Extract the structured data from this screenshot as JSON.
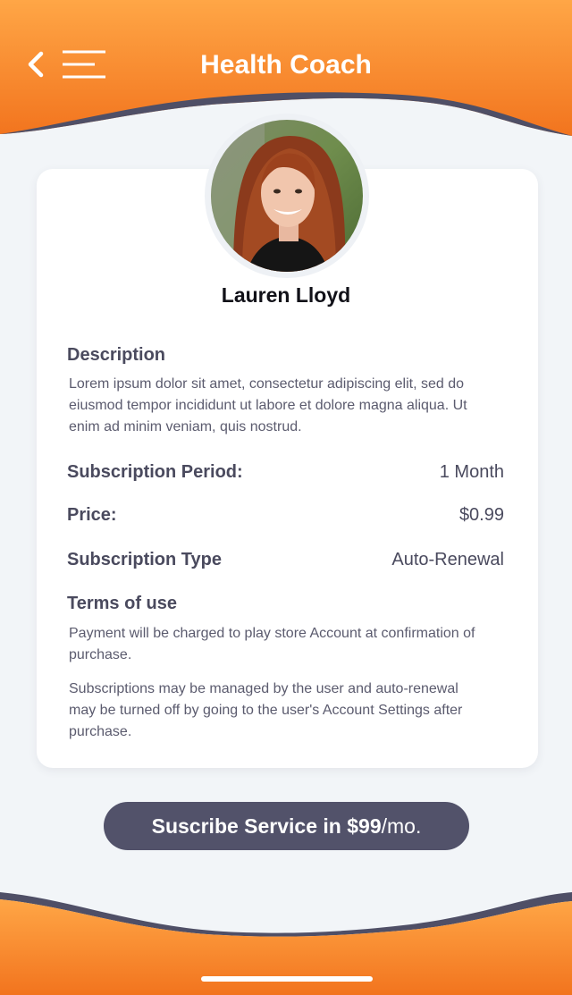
{
  "header": {
    "title": "Health Coach",
    "back_icon": "chevron-left-icon",
    "menu_icon": "hamburger-menu-icon"
  },
  "colors": {
    "orange_top": "#ffa646",
    "orange_bottom": "#f2741e",
    "dark": "#4f4f66",
    "background": "#f2f5f8"
  },
  "profile": {
    "name": "Lauren Lloyd"
  },
  "description": {
    "heading": "Description",
    "lines": [
      "Lorem ipsum dolor sit amet, consectetur adipiscing elit, sed do",
      "eiusmod tempor incididunt ut labore et dolore magna aliqua. Ut",
      "enim ad minim veniam, quis nostrud."
    ]
  },
  "details": [
    {
      "label": "Subscription Period:",
      "value": "1 Month"
    },
    {
      "label": "Price:",
      "value": "$0.99"
    },
    {
      "label": "Subscription Type",
      "value": "Auto-Renewal"
    }
  ],
  "terms": {
    "heading": "Terms of use",
    "paragraph1": [
      "Payment will be charged to play store Account at confirmation of",
      "purchase."
    ],
    "paragraph2": [
      "Subscriptions may be managed by the user and auto-renewal",
      "may be turned off by going to the user's Account Settings after",
      "purchase."
    ]
  },
  "cta": {
    "prefix": "Suscribe Service in ",
    "price": "$99",
    "suffix": "/mo."
  }
}
